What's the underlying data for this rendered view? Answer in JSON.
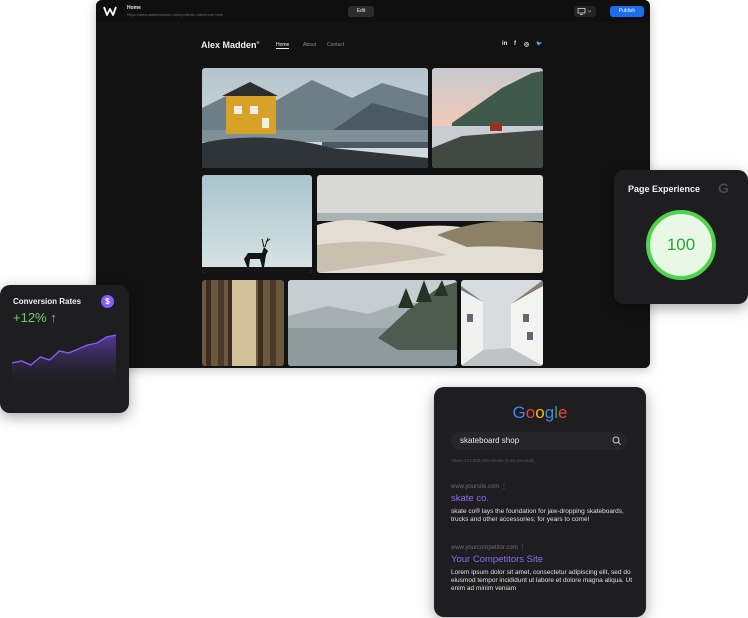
{
  "editor": {
    "page_title": "Home",
    "page_url": "https://alexmaddenstudio.com/portfolio-site/home.html",
    "edit_label": "Edit",
    "publish_label": "Publish"
  },
  "site": {
    "brand": "Alex Madden",
    "brand_mark": "®",
    "nav": [
      "Home",
      "About",
      "Contact"
    ],
    "social": [
      "in",
      "f",
      "◎",
      "🐦"
    ]
  },
  "page_experience": {
    "title": "Page Experience",
    "g_mark": "G",
    "score": "100"
  },
  "conversion": {
    "title": "Conversion Rates",
    "currency_icon": "$",
    "value": "+12% ↑",
    "trend": [
      30,
      28,
      32,
      24,
      27,
      18,
      20,
      16,
      12,
      10,
      4,
      2
    ],
    "colors": {
      "line": "#8a5cf6",
      "positive": "#6fd06f"
    }
  },
  "search": {
    "logo": [
      {
        "ch": "G",
        "color": "#4285f4"
      },
      {
        "ch": "o",
        "color": "#ea4335"
      },
      {
        "ch": "o",
        "color": "#fbbc05"
      },
      {
        "ch": "g",
        "color": "#4285f4"
      },
      {
        "ch": "l",
        "color": "#34a853"
      },
      {
        "ch": "e",
        "color": "#ea4335"
      }
    ],
    "query": "skateboard shop",
    "stats": "About 173,000,000 results (0.62 seconds)",
    "results": [
      {
        "url": "www.yoursite.com  ⋮",
        "title": "skate co.",
        "desc": "skate co® lays the foundation for jaw-dropping skateboards, trucks and other accessories; for years to come!"
      },
      {
        "url": "www.yourcompetitor.com  ⋮",
        "title": "Your Competitors Site",
        "desc": "Lorem ipsum dolor sit amet, consectetur adipiscing elit, sed do eiusmod tempor incididunt ut labore et dolore magna aliqua. Ut enim ad minim veniam"
      }
    ]
  }
}
